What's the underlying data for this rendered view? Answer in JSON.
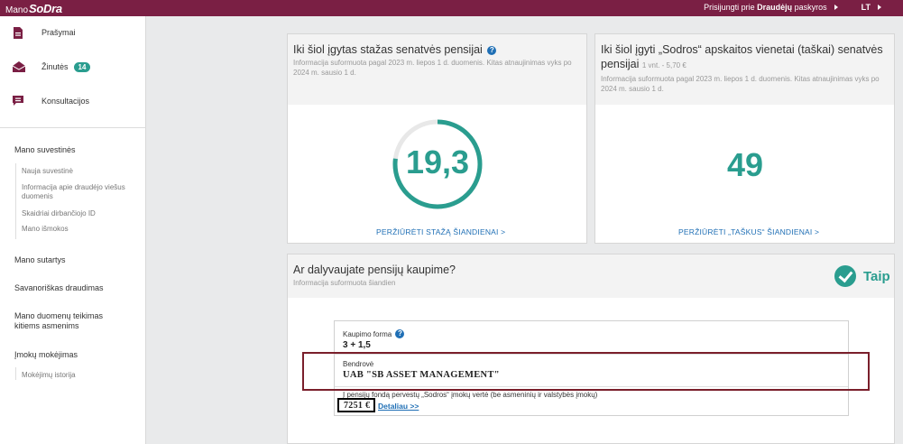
{
  "header": {
    "logo_prefix": "Mano",
    "logo_brand": "SoDra",
    "login_text": "Prisijungti prie ",
    "login_bold": "Draudėjų",
    "login_suffix": " paskyros",
    "lang": "LT"
  },
  "sidebar": {
    "main_items": [
      {
        "label": "Prašymai",
        "icon": "document-icon"
      },
      {
        "label": "Žinutės",
        "icon": "envelope-icon",
        "badge": "14"
      },
      {
        "label": "Konsultacijos",
        "icon": "chat-icon"
      }
    ],
    "summaries": {
      "title": "Mano suvestinės",
      "items": [
        "Nauja suvestinė",
        "Informacija apie draudėjo viešus duomenis",
        "Skaidriai dirbančiojo ID",
        "Mano išmokos"
      ]
    },
    "contracts": "Mano sutartys",
    "voluntary": "Savanoriškas draudimas",
    "data_sharing": "Mano duomenų teikimas kitiems asmenims",
    "payments": {
      "title": "Įmokų mokėjimas",
      "items": [
        "Mokėjimų istorija"
      ]
    }
  },
  "stazas": {
    "title": "Iki šiol įgytas stažas senatvės pensijai",
    "note": "Informacija suformuota pagal 2023 m. liepos 1 d. duomenis. Kitas atnaujinimas vyks po 2024 m. sausio 1 d.",
    "value": "19,3",
    "progress_fraction": 0.77,
    "link": "PERŽIŪRĖTI STAŽĄ ŠIANDIENAI >"
  },
  "taskai": {
    "title": "Iki šiol įgyti „Sodros“ apskaitos vienetai (taškai) senatvės pensijai",
    "unit_note": "1 vnt. - 5,70 €",
    "note": "Informacija suformuota pagal 2023 m. liepos 1 d. duomenis. Kitas atnaujinimas vyks po 2024 m. sausio 1 d.",
    "value": "49",
    "link": "PERŽIŪRĖTI „TAŠKUS“ ŠIANDIENAI >"
  },
  "kaupimas": {
    "title": "Ar dalyvaujate pensijų kaupime?",
    "note": "Informacija suformuota šiandien",
    "answer": "Taip",
    "form_label": "Kaupimo forma",
    "form_value": "3 + 1,5",
    "company_label": "Bendrovė",
    "company_value": "UAB \"SB ASSET MANAGEMENT\"",
    "transfer_label": "Į pensijų fondą pervestų „Sodros“ įmokų vertė (be asmeninių ir valstybės įmokų)",
    "transfer_value": "7251 €",
    "detail_link": "Detaliau >>"
  },
  "colors": {
    "brand": "#7a1f44",
    "accent": "#2a9d8f",
    "link": "#1f6fb5"
  }
}
